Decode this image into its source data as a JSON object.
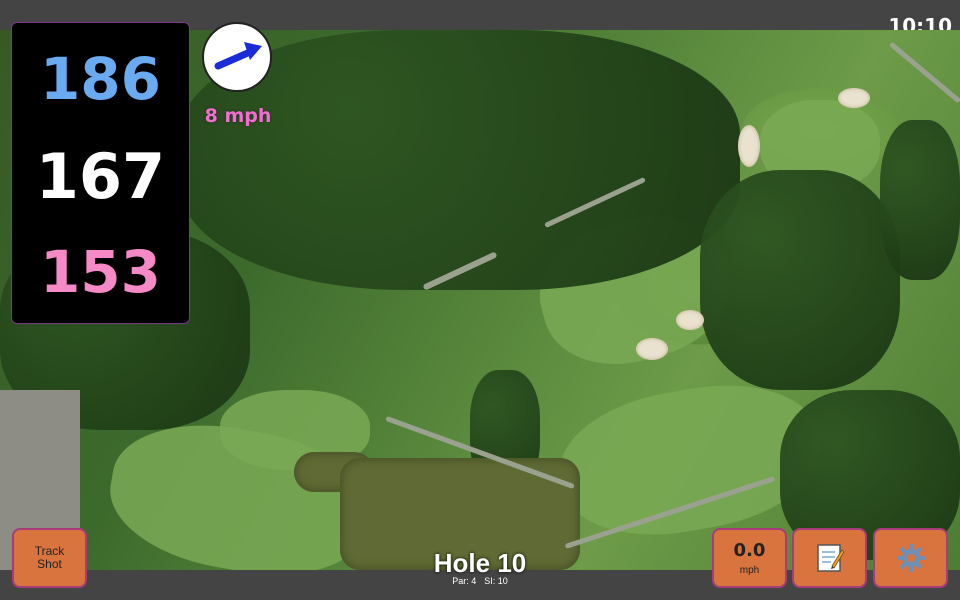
{
  "status_bar": {
    "time": "10:10"
  },
  "distances": {
    "back": "186",
    "middle": "167",
    "front": "153"
  },
  "wind": {
    "speed": "8 mph",
    "direction_icon": "arrow-icon"
  },
  "hole": {
    "title": "Hole 10",
    "par": "Par: 4",
    "stroke_index": "SI: 10"
  },
  "buttons": {
    "track_shot": "Track\nShot",
    "speed_value": "0.0",
    "speed_unit": "mph",
    "scorecard_icon": "notepad-icon",
    "settings_icon": "gear-icon"
  },
  "colors": {
    "back_distance": "#6aaaf0",
    "middle_distance": "#ffffff",
    "front_distance": "#f58ac6",
    "button_fill": "#d9743e",
    "button_border": "#a73c7a",
    "wind_text": "#f26fd1"
  }
}
